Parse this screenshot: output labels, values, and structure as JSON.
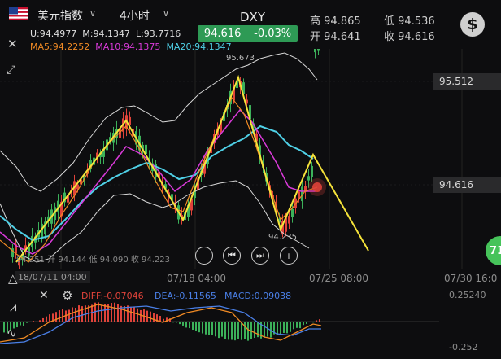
{
  "header": {
    "symbol": "美元指数",
    "timeframe": "4小时",
    "ticker": "DXY",
    "price": "94.616",
    "change": "-0.03%",
    "high_label": "高",
    "high_value": "94.865",
    "low_label": "低",
    "low_value": "94.536",
    "open_label": "开",
    "open_value": "94.641",
    "close_label": "收",
    "close_value": "94.616",
    "currency_icon": "$"
  },
  "ohlc_line": {
    "u": "U:94.4977",
    "m": "M:94.1347",
    "l": "L:93.7716"
  },
  "ma_line": {
    "ma5": "MA5:94.2252",
    "ma10": "MA10:94.1375",
    "ma20": "MA20:94.1347"
  },
  "price_tags": {
    "upper": "95.512",
    "current": "94.616"
  },
  "chart_labels": {
    "high": "95.673",
    "low": "94.235",
    "prev_bar": "94.251 开 94.144 低 94.090 收 94.223",
    "crosshair_date": "18/07/11 04:00"
  },
  "dates": [
    "07/18 04:00",
    "07/25 08:00",
    "07/30 16:0"
  ],
  "edge_badge": "71",
  "macd": {
    "diff": "DIFF:-0.07046",
    "dea": "DEA:-0.11565",
    "macd": "MACD:0.09038",
    "scale_top": "0.25240",
    "scale_bottom": "-0.252"
  },
  "colors": {
    "up": "#e0433a",
    "down": "#3cb15a",
    "ma5": "#f08a24",
    "ma10": "#d93ad9",
    "ma20": "#4fd0e6",
    "zigzag": "#f5e33a",
    "accent": "#2e9a55"
  },
  "icons": [
    "flag-us-icon",
    "chevron-down-icon",
    "dollar-icon",
    "close-icon",
    "expand-icon",
    "zoom-out-icon",
    "prev-icon",
    "next-icon",
    "zoom-in-icon",
    "settings-icon",
    "draw-tool-icon",
    "indicator-icon"
  ]
}
